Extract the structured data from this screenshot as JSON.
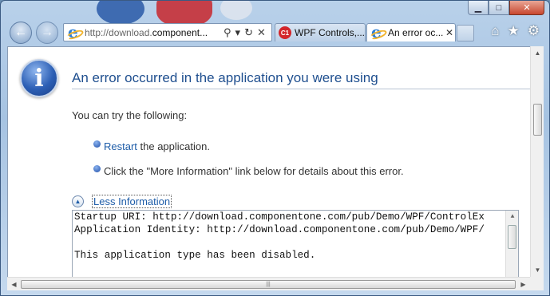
{
  "window": {
    "caption": {
      "minimize": "▁",
      "maximize": "□",
      "close": "✕"
    }
  },
  "navigation": {
    "back_icon": "back-arrow-icon",
    "forward_icon": "forward-arrow-icon",
    "address": {
      "url_prefix": "http://download.",
      "url_domain": "component...",
      "url_full": "http://download.componentone.com/pub/Demo/WPF/ControlExplorer"
    },
    "search_glyph": "⚲",
    "dropdown_glyph": "▾",
    "refresh_glyph": "↻",
    "stop_glyph": "✕"
  },
  "tabs": [
    {
      "label": "WPF Controls,...",
      "icon": "componentone-icon",
      "active": false
    },
    {
      "label": "An error oc...",
      "icon": "ie-icon",
      "active": true,
      "close": "✕"
    }
  ],
  "toolbar": {
    "home": "⌂",
    "favorites": "★",
    "tools": "⚙"
  },
  "page": {
    "title": "An error occurred in the application you were using",
    "subtitle": "You can try the following:",
    "restart_link": "Restart",
    "restart_text": " the application.",
    "more_info_text": "Click the \"More Information\" link below for details about this error.",
    "less_info_label": "Less Information",
    "details_text": "Startup URI: http://download.componentone.com/pub/Demo/WPF/ControlEx\nApplication Identity: http://download.componentone.com/pub/Demo/WPF/\n\nThis application type has been disabled."
  },
  "colors": {
    "title": "#1f4f8f",
    "link": "#1d5ca8",
    "close_button": "#c8472e"
  }
}
